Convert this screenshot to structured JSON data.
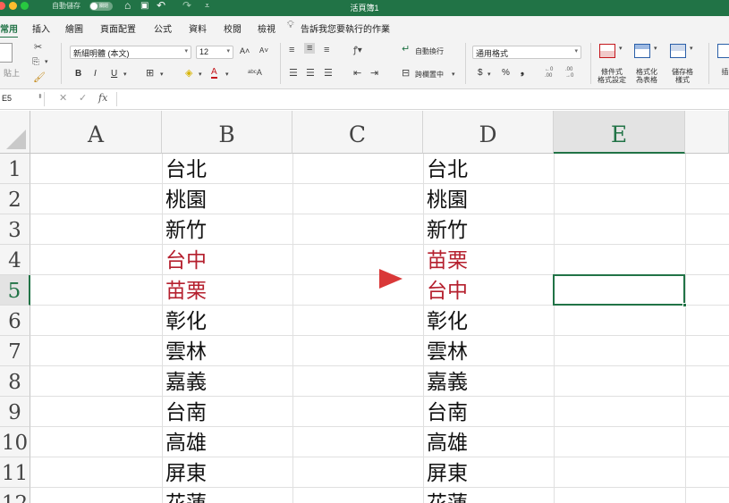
{
  "titlebar": {
    "autosave_label": "自動儲存",
    "toggle_label": "關閉",
    "title": "活頁簿1",
    "icons": [
      "home-icon",
      "save-icon",
      "undo-icon",
      "redo-icon",
      "customize-icon"
    ]
  },
  "tabs": [
    {
      "label": "常用",
      "active": true
    },
    {
      "label": "插入"
    },
    {
      "label": "繪圖"
    },
    {
      "label": "頁面配置"
    },
    {
      "label": "公式"
    },
    {
      "label": "資料"
    },
    {
      "label": "校閱"
    },
    {
      "label": "檢視"
    }
  ],
  "tellme": "告訴我您要執行的作業",
  "ribbon": {
    "paste_label": "貼上",
    "font_name": "新細明體 (本文)",
    "font_size": "12",
    "grow_font": "A˄",
    "shrink_font": "A˅",
    "bold": "B",
    "italic": "I",
    "underline": "U",
    "wrap_text": "自動換行",
    "merge_center": "跨欄置中",
    "number_format": "通用格式",
    "currency": "$",
    "percent": "%",
    "comma": "❟",
    "inc_decimal": "←0\n.00",
    "dec_decimal": ".00\n→0",
    "conditional_format": "條件式\n格式設定",
    "format_as_table": "格式化\n為表格",
    "cell_styles": "儲存格\n樣式",
    "insert_partial": "插"
  },
  "formula_bar": {
    "name_box": "E5",
    "fx": "fx"
  },
  "columns": [
    "A",
    "B",
    "C",
    "D",
    "E"
  ],
  "selected_column": "E",
  "rows": [
    "1",
    "2",
    "3",
    "4",
    "5",
    "6",
    "7",
    "8",
    "9",
    "10",
    "11",
    "12"
  ],
  "selected_row": "5",
  "column_b": [
    "台北",
    "桃園",
    "新竹",
    "台中",
    "苗栗",
    "彰化",
    "雲林",
    "嘉義",
    "台南",
    "高雄",
    "屏東",
    "花蓮"
  ],
  "column_d": [
    "台北",
    "桃園",
    "新竹",
    "苗栗",
    "台中",
    "彰化",
    "雲林",
    "嘉義",
    "台南",
    "高雄",
    "屏東",
    "花蓮"
  ],
  "highlight_color": "#b5202e",
  "arrow_color": "#e04848",
  "accent_color": "#217346"
}
